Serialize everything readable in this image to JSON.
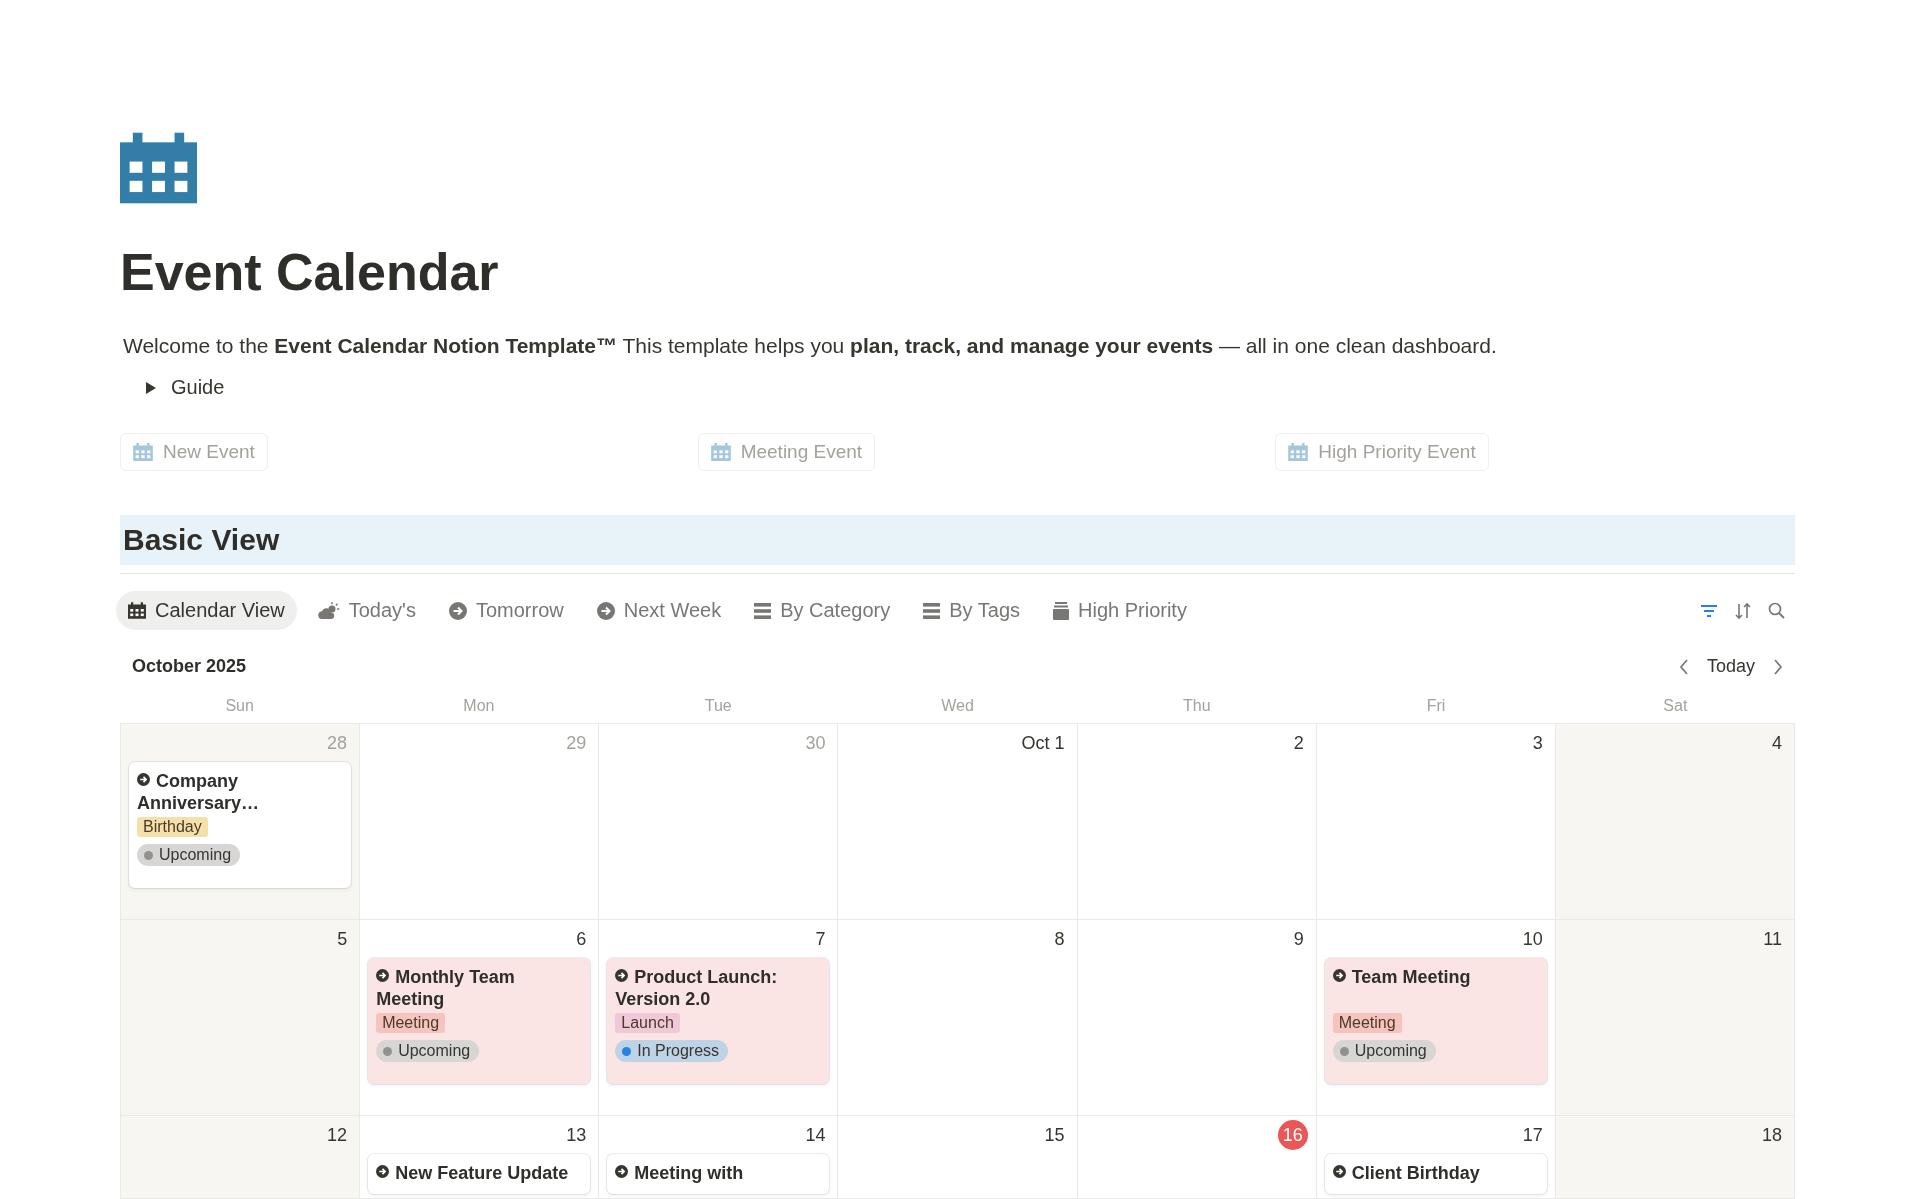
{
  "page": {
    "title": "Event Calendar",
    "intro": "Welcome to the **Event Calendar Notion Template™** This template helps you **plan, track, and manage your events** — all in one clean dashboard.",
    "guide": {
      "label": "Guide",
      "expanded": false
    }
  },
  "template_buttons": [
    {
      "label": "New Event"
    },
    {
      "label": "Meeting Event"
    },
    {
      "label": "High Priority Event"
    }
  ],
  "section": {
    "title": "Basic View"
  },
  "view_tabs": [
    {
      "label": "Calendar View",
      "selected": true
    },
    {
      "label": "Today's",
      "selected": false
    },
    {
      "label": "Tomorrow",
      "selected": false
    },
    {
      "label": "Next Week",
      "selected": false
    },
    {
      "label": "By Category",
      "selected": false
    },
    {
      "label": "By Tags",
      "selected": false
    },
    {
      "label": "High Priority",
      "selected": false
    }
  ],
  "calendar": {
    "month": "October 2025",
    "today_button": "Today",
    "weekdays": [
      "Sun",
      "Mon",
      "Tue",
      "Wed",
      "Thu",
      "Fri",
      "Sat"
    ],
    "weeks": [
      [
        {
          "day": "28",
          "outside_month": true,
          "today": false,
          "events": [
            {
              "title": "Company Anniversary…",
              "color": "#ffffff",
              "tag": {
                "label": "Birthday",
                "color": "#f5e0a9"
              },
              "status": {
                "label": "Upcoming",
                "color": "#91918e"
              }
            }
          ]
        },
        {
          "day": "29",
          "outside_month": true,
          "today": false
        },
        {
          "day": "30",
          "outside_month": true,
          "today": false
        },
        {
          "day": "Oct 1",
          "outside_month": false,
          "today": false
        },
        {
          "day": "2",
          "outside_month": false,
          "today": false
        },
        {
          "day": "3",
          "outside_month": false,
          "today": false
        },
        {
          "day": "4",
          "outside_month": false,
          "today": false
        }
      ],
      [
        {
          "day": "5",
          "outside_month": false,
          "today": false
        },
        {
          "day": "6",
          "outside_month": false,
          "today": false,
          "events": [
            {
              "title": "Monthly Team Meeting",
              "color": "#fbe4e4",
              "tag": {
                "label": "Meeting",
                "color": "#f6c4bd"
              },
              "status": {
                "label": "Upcoming",
                "color": "#91918e"
              }
            }
          ]
        },
        {
          "day": "7",
          "outside_month": false,
          "today": false,
          "events": [
            {
              "title": "Product Launch: Version 2.0",
              "color": "#fbe4e4",
              "tag": {
                "label": "Launch",
                "color": "#f1c8d8"
              },
              "status": {
                "label": "In Progress",
                "color": "#2383e2"
              }
            }
          ]
        },
        {
          "day": "8",
          "outside_month": false,
          "today": false
        },
        {
          "day": "9",
          "outside_month": false,
          "today": false
        },
        {
          "day": "10",
          "outside_month": false,
          "today": false,
          "events": [
            {
              "title": "Team Meeting",
              "color": "#fbe4e4",
              "tag": {
                "label": "Meeting",
                "color": "#f6c4bd"
              },
              "status": {
                "label": "Upcoming",
                "color": "#91918e"
              }
            }
          ]
        },
        {
          "day": "11",
          "outside_month": false,
          "today": false
        }
      ],
      [
        {
          "day": "12",
          "outside_month": false,
          "today": false
        },
        {
          "day": "13",
          "outside_month": false,
          "today": false,
          "events": [
            {
              "title": "New Feature Update",
              "color": "#ffffff"
            }
          ]
        },
        {
          "day": "14",
          "outside_month": false,
          "today": false,
          "events": [
            {
              "title": "Meeting with",
              "color": "#ffffff"
            }
          ]
        },
        {
          "day": "15",
          "outside_month": false,
          "today": false
        },
        {
          "day": "16",
          "outside_month": false,
          "today": true
        },
        {
          "day": "17",
          "outside_month": false,
          "today": false,
          "events": [
            {
              "title": "Client Birthday",
              "color": "#ffffff"
            }
          ]
        },
        {
          "day": "18",
          "outside_month": false,
          "today": false
        }
      ]
    ]
  }
}
